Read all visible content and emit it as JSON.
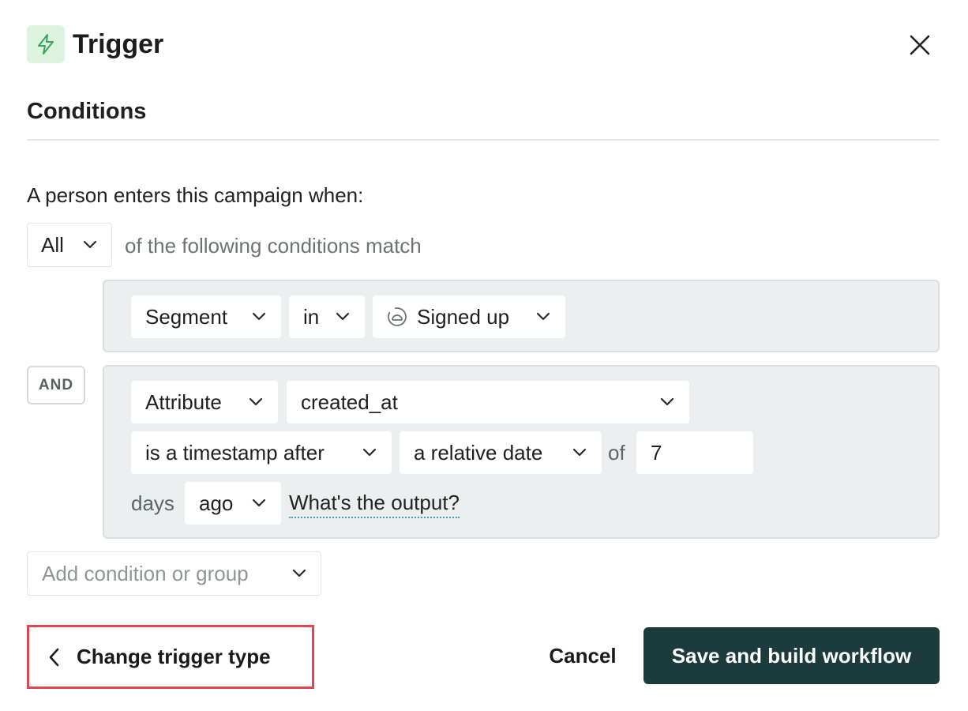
{
  "header": {
    "title": "Trigger",
    "icon": "lightning-bolt-icon",
    "close_icon": "close-icon"
  },
  "conditions": {
    "section_title": "Conditions",
    "intro": "A person enters this campaign when:",
    "match_select": "All",
    "match_text": "of the following conditions match",
    "group1": {
      "field_select": "Segment",
      "operator_select": "in",
      "segment_icon": "segment-icon",
      "value_select": "Signed up"
    },
    "and_badge": "AND",
    "group2": {
      "field_select": "Attribute",
      "attribute_select": "created_at",
      "comparison_select": "is a timestamp after",
      "date_type_select": "a relative date",
      "of_label": "of",
      "number_value": "7",
      "days_label": "days",
      "direction_select": "ago",
      "output_link": "What's the output?"
    },
    "add_condition": "Add condition or group"
  },
  "footer": {
    "change_trigger": "Change trigger type",
    "cancel": "Cancel",
    "save": "Save and build workflow"
  },
  "colors": {
    "primary_button": "#1b3b3c",
    "highlight_border": "#e0464f",
    "icon_bg": "#dcf3df",
    "icon_stroke": "#3aa35a",
    "group_bg": "#ebefef"
  }
}
